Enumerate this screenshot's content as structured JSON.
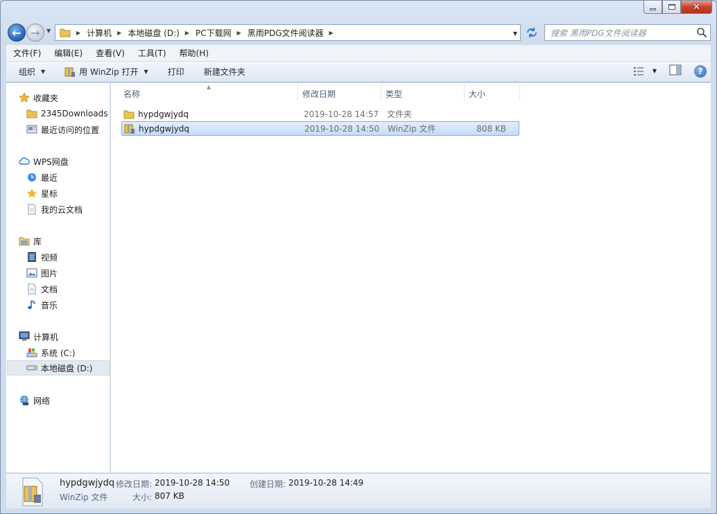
{
  "window": {
    "caption": {
      "minimize": "minimize",
      "maximize": "maximize",
      "close": "close"
    }
  },
  "address": {
    "crumbs": [
      "计算机",
      "本地磁盘 (D:)",
      "PC下载网",
      "黑雨PDG文件阅读器"
    ],
    "search_placeholder": "搜索 黑雨PDG文件阅读器"
  },
  "menubar": {
    "items": [
      "文件(F)",
      "编辑(E)",
      "查看(V)",
      "工具(T)",
      "帮助(H)"
    ]
  },
  "toolbar": {
    "organize": "组织",
    "open_with": "用 WinZip 打开",
    "print": "打印",
    "new_folder": "新建文件夹"
  },
  "navpane": {
    "favorites": {
      "label": "收藏夹",
      "items": [
        "2345Downloads",
        "最近访问的位置"
      ]
    },
    "wps": {
      "label": "WPS网盘",
      "items": [
        "最近",
        "星标",
        "我的云文档"
      ]
    },
    "libraries": {
      "label": "库",
      "items": [
        "视频",
        "图片",
        "文档",
        "音乐"
      ]
    },
    "computer": {
      "label": "计算机",
      "items": [
        "系统 (C:)",
        "本地磁盘 (D:)"
      ]
    },
    "network": {
      "label": "网络"
    }
  },
  "columns": {
    "name": "名称",
    "date": "修改日期",
    "type": "类型",
    "size": "大小"
  },
  "files": [
    {
      "name": "hypdgwjydq",
      "date": "2019-10-28 14:57",
      "type": "文件夹",
      "size": "",
      "icon": "folder-icon"
    },
    {
      "name": "hypdgwjydq",
      "date": "2019-10-28 14:50",
      "type": "WinZip 文件",
      "size": "808 KB",
      "icon": "winzip-icon"
    }
  ],
  "details": {
    "name": "hypdgwjydq",
    "type": "WinZip 文件",
    "modified_label": "修改日期:",
    "modified_value": "2019-10-28 14:50",
    "created_label": "创建日期:",
    "created_value": "2019-10-28 14:49",
    "size_label": "大小:",
    "size_value": "807 KB"
  },
  "colors": {
    "selection": "#cce1f7",
    "nav_selected": "#e4e9ef",
    "folder": "#e9c25a"
  }
}
